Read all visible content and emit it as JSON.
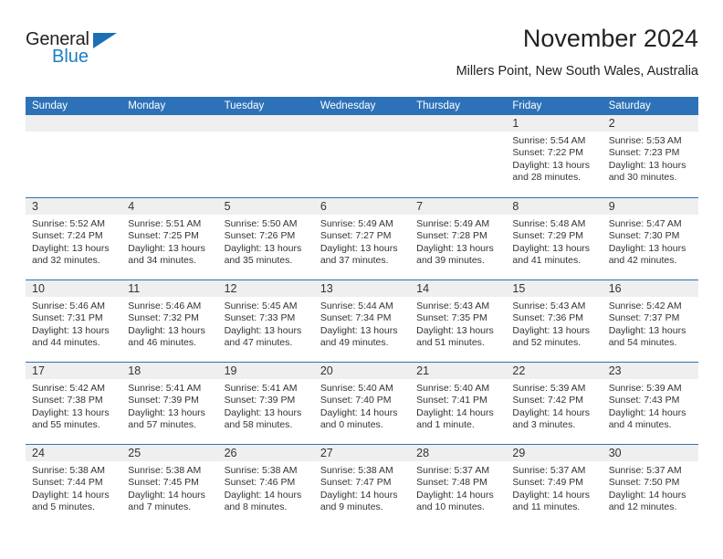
{
  "brand": {
    "name_part1": "General",
    "name_part2": "Blue"
  },
  "header": {
    "title": "November 2024",
    "location": "Millers Point, New South Wales, Australia"
  },
  "colors": {
    "header_blue": "#2d72b8",
    "brand_blue": "#1b7fc4",
    "daynum_band": "#efefef"
  },
  "weekdays": [
    "Sunday",
    "Monday",
    "Tuesday",
    "Wednesday",
    "Thursday",
    "Friday",
    "Saturday"
  ],
  "weeks": [
    [
      {
        "day": "",
        "sunrise": "",
        "sunset": "",
        "daylight1": "",
        "daylight2": ""
      },
      {
        "day": "",
        "sunrise": "",
        "sunset": "",
        "daylight1": "",
        "daylight2": ""
      },
      {
        "day": "",
        "sunrise": "",
        "sunset": "",
        "daylight1": "",
        "daylight2": ""
      },
      {
        "day": "",
        "sunrise": "",
        "sunset": "",
        "daylight1": "",
        "daylight2": ""
      },
      {
        "day": "",
        "sunrise": "",
        "sunset": "",
        "daylight1": "",
        "daylight2": ""
      },
      {
        "day": "1",
        "sunrise": "Sunrise: 5:54 AM",
        "sunset": "Sunset: 7:22 PM",
        "daylight1": "Daylight: 13 hours",
        "daylight2": "and 28 minutes."
      },
      {
        "day": "2",
        "sunrise": "Sunrise: 5:53 AM",
        "sunset": "Sunset: 7:23 PM",
        "daylight1": "Daylight: 13 hours",
        "daylight2": "and 30 minutes."
      }
    ],
    [
      {
        "day": "3",
        "sunrise": "Sunrise: 5:52 AM",
        "sunset": "Sunset: 7:24 PM",
        "daylight1": "Daylight: 13 hours",
        "daylight2": "and 32 minutes."
      },
      {
        "day": "4",
        "sunrise": "Sunrise: 5:51 AM",
        "sunset": "Sunset: 7:25 PM",
        "daylight1": "Daylight: 13 hours",
        "daylight2": "and 34 minutes."
      },
      {
        "day": "5",
        "sunrise": "Sunrise: 5:50 AM",
        "sunset": "Sunset: 7:26 PM",
        "daylight1": "Daylight: 13 hours",
        "daylight2": "and 35 minutes."
      },
      {
        "day": "6",
        "sunrise": "Sunrise: 5:49 AM",
        "sunset": "Sunset: 7:27 PM",
        "daylight1": "Daylight: 13 hours",
        "daylight2": "and 37 minutes."
      },
      {
        "day": "7",
        "sunrise": "Sunrise: 5:49 AM",
        "sunset": "Sunset: 7:28 PM",
        "daylight1": "Daylight: 13 hours",
        "daylight2": "and 39 minutes."
      },
      {
        "day": "8",
        "sunrise": "Sunrise: 5:48 AM",
        "sunset": "Sunset: 7:29 PM",
        "daylight1": "Daylight: 13 hours",
        "daylight2": "and 41 minutes."
      },
      {
        "day": "9",
        "sunrise": "Sunrise: 5:47 AM",
        "sunset": "Sunset: 7:30 PM",
        "daylight1": "Daylight: 13 hours",
        "daylight2": "and 42 minutes."
      }
    ],
    [
      {
        "day": "10",
        "sunrise": "Sunrise: 5:46 AM",
        "sunset": "Sunset: 7:31 PM",
        "daylight1": "Daylight: 13 hours",
        "daylight2": "and 44 minutes."
      },
      {
        "day": "11",
        "sunrise": "Sunrise: 5:46 AM",
        "sunset": "Sunset: 7:32 PM",
        "daylight1": "Daylight: 13 hours",
        "daylight2": "and 46 minutes."
      },
      {
        "day": "12",
        "sunrise": "Sunrise: 5:45 AM",
        "sunset": "Sunset: 7:33 PM",
        "daylight1": "Daylight: 13 hours",
        "daylight2": "and 47 minutes."
      },
      {
        "day": "13",
        "sunrise": "Sunrise: 5:44 AM",
        "sunset": "Sunset: 7:34 PM",
        "daylight1": "Daylight: 13 hours",
        "daylight2": "and 49 minutes."
      },
      {
        "day": "14",
        "sunrise": "Sunrise: 5:43 AM",
        "sunset": "Sunset: 7:35 PM",
        "daylight1": "Daylight: 13 hours",
        "daylight2": "and 51 minutes."
      },
      {
        "day": "15",
        "sunrise": "Sunrise: 5:43 AM",
        "sunset": "Sunset: 7:36 PM",
        "daylight1": "Daylight: 13 hours",
        "daylight2": "and 52 minutes."
      },
      {
        "day": "16",
        "sunrise": "Sunrise: 5:42 AM",
        "sunset": "Sunset: 7:37 PM",
        "daylight1": "Daylight: 13 hours",
        "daylight2": "and 54 minutes."
      }
    ],
    [
      {
        "day": "17",
        "sunrise": "Sunrise: 5:42 AM",
        "sunset": "Sunset: 7:38 PM",
        "daylight1": "Daylight: 13 hours",
        "daylight2": "and 55 minutes."
      },
      {
        "day": "18",
        "sunrise": "Sunrise: 5:41 AM",
        "sunset": "Sunset: 7:39 PM",
        "daylight1": "Daylight: 13 hours",
        "daylight2": "and 57 minutes."
      },
      {
        "day": "19",
        "sunrise": "Sunrise: 5:41 AM",
        "sunset": "Sunset: 7:39 PM",
        "daylight1": "Daylight: 13 hours",
        "daylight2": "and 58 minutes."
      },
      {
        "day": "20",
        "sunrise": "Sunrise: 5:40 AM",
        "sunset": "Sunset: 7:40 PM",
        "daylight1": "Daylight: 14 hours",
        "daylight2": "and 0 minutes."
      },
      {
        "day": "21",
        "sunrise": "Sunrise: 5:40 AM",
        "sunset": "Sunset: 7:41 PM",
        "daylight1": "Daylight: 14 hours",
        "daylight2": "and 1 minute."
      },
      {
        "day": "22",
        "sunrise": "Sunrise: 5:39 AM",
        "sunset": "Sunset: 7:42 PM",
        "daylight1": "Daylight: 14 hours",
        "daylight2": "and 3 minutes."
      },
      {
        "day": "23",
        "sunrise": "Sunrise: 5:39 AM",
        "sunset": "Sunset: 7:43 PM",
        "daylight1": "Daylight: 14 hours",
        "daylight2": "and 4 minutes."
      }
    ],
    [
      {
        "day": "24",
        "sunrise": "Sunrise: 5:38 AM",
        "sunset": "Sunset: 7:44 PM",
        "daylight1": "Daylight: 14 hours",
        "daylight2": "and 5 minutes."
      },
      {
        "day": "25",
        "sunrise": "Sunrise: 5:38 AM",
        "sunset": "Sunset: 7:45 PM",
        "daylight1": "Daylight: 14 hours",
        "daylight2": "and 7 minutes."
      },
      {
        "day": "26",
        "sunrise": "Sunrise: 5:38 AM",
        "sunset": "Sunset: 7:46 PM",
        "daylight1": "Daylight: 14 hours",
        "daylight2": "and 8 minutes."
      },
      {
        "day": "27",
        "sunrise": "Sunrise: 5:38 AM",
        "sunset": "Sunset: 7:47 PM",
        "daylight1": "Daylight: 14 hours",
        "daylight2": "and 9 minutes."
      },
      {
        "day": "28",
        "sunrise": "Sunrise: 5:37 AM",
        "sunset": "Sunset: 7:48 PM",
        "daylight1": "Daylight: 14 hours",
        "daylight2": "and 10 minutes."
      },
      {
        "day": "29",
        "sunrise": "Sunrise: 5:37 AM",
        "sunset": "Sunset: 7:49 PM",
        "daylight1": "Daylight: 14 hours",
        "daylight2": "and 11 minutes."
      },
      {
        "day": "30",
        "sunrise": "Sunrise: 5:37 AM",
        "sunset": "Sunset: 7:50 PM",
        "daylight1": "Daylight: 14 hours",
        "daylight2": "and 12 minutes."
      }
    ]
  ]
}
